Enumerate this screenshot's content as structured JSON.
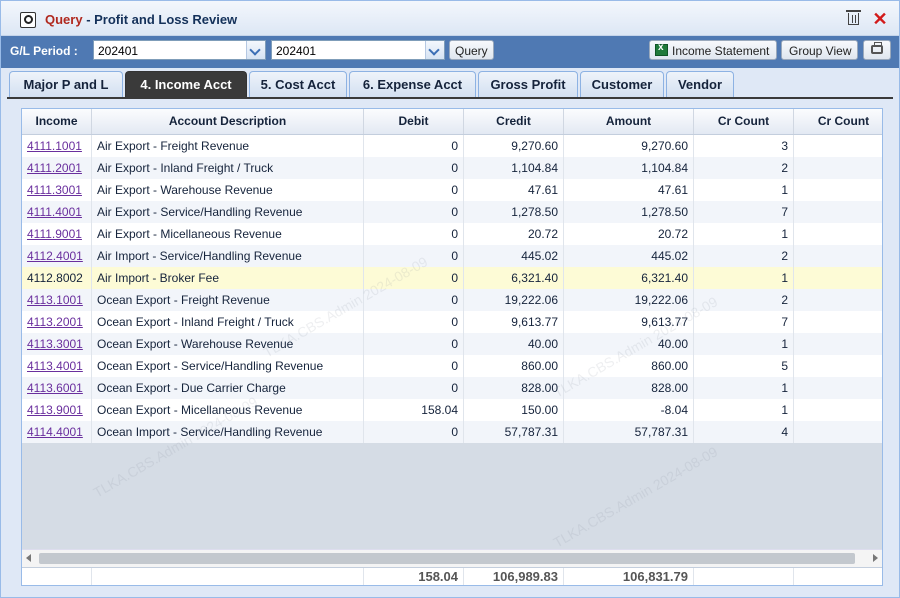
{
  "window": {
    "title_prefix": "Query",
    "title_rest": " - Profit and Loss Review"
  },
  "toolbar": {
    "gl_period_label": "G/L Period :",
    "period_from": "202401",
    "period_to": "202401",
    "query_label": "Query",
    "income_statement_label": "Income Statement",
    "group_view_label": "Group View"
  },
  "tabs": [
    {
      "label": "Major P and L",
      "active": false
    },
    {
      "label": "4. Income Acct",
      "active": true
    },
    {
      "label": "5. Cost Acct",
      "active": false
    },
    {
      "label": "6. Expense Acct",
      "active": false
    },
    {
      "label": "Gross Profit",
      "active": false
    },
    {
      "label": "Customer",
      "active": false
    },
    {
      "label": "Vendor",
      "active": false
    }
  ],
  "grid": {
    "columns": [
      "Income",
      "Account Description",
      "Debit",
      "Credit",
      "Amount",
      "Cr Count",
      "Cr Count"
    ],
    "rows": [
      {
        "acct": "4111.1001",
        "desc": "Air Export - Freight Revenue",
        "debit": "0",
        "credit": "9,270.60",
        "amount": "9,270.60",
        "cr_count": "3"
      },
      {
        "acct": "4111.2001",
        "desc": "Air Export - Inland Freight / Truck",
        "debit": "0",
        "credit": "1,104.84",
        "amount": "1,104.84",
        "cr_count": "2"
      },
      {
        "acct": "4111.3001",
        "desc": "Air Export - Warehouse Revenue",
        "debit": "0",
        "credit": "47.61",
        "amount": "47.61",
        "cr_count": "1"
      },
      {
        "acct": "4111.4001",
        "desc": "Air Export - Service/Handling Revenue",
        "debit": "0",
        "credit": "1,278.50",
        "amount": "1,278.50",
        "cr_count": "7"
      },
      {
        "acct": "4111.9001",
        "desc": "Air Export - Micellaneous Revenue",
        "debit": "0",
        "credit": "20.72",
        "amount": "20.72",
        "cr_count": "1"
      },
      {
        "acct": "4112.4001",
        "desc": "Air Import - Service/Handling Revenue",
        "debit": "0",
        "credit": "445.02",
        "amount": "445.02",
        "cr_count": "2"
      },
      {
        "acct": "4112.8002",
        "desc": "Air Import - Broker Fee",
        "debit": "0",
        "credit": "6,321.40",
        "amount": "6,321.40",
        "cr_count": "1"
      },
      {
        "acct": "4113.1001",
        "desc": "Ocean Export - Freight Revenue",
        "debit": "0",
        "credit": "19,222.06",
        "amount": "19,222.06",
        "cr_count": "2"
      },
      {
        "acct": "4113.2001",
        "desc": "Ocean Export - Inland Freight / Truck",
        "debit": "0",
        "credit": "9,613.77",
        "amount": "9,613.77",
        "cr_count": "7"
      },
      {
        "acct": "4113.3001",
        "desc": "Ocean Export - Warehouse Revenue",
        "debit": "0",
        "credit": "40.00",
        "amount": "40.00",
        "cr_count": "1"
      },
      {
        "acct": "4113.4001",
        "desc": "Ocean Export - Service/Handling Revenue",
        "debit": "0",
        "credit": "860.00",
        "amount": "860.00",
        "cr_count": "5"
      },
      {
        "acct": "4113.6001",
        "desc": "Ocean Export - Due Carrier Charge",
        "debit": "0",
        "credit": "828.00",
        "amount": "828.00",
        "cr_count": "1"
      },
      {
        "acct": "4113.9001",
        "desc": "Ocean Export - Micellaneous Revenue",
        "debit": "158.04",
        "credit": "150.00",
        "amount": "-8.04",
        "cr_count": "1"
      },
      {
        "acct": "4114.4001",
        "desc": "Ocean Import - Service/Handling Revenue",
        "debit": "0",
        "credit": "57,787.31",
        "amount": "57,787.31",
        "cr_count": "4"
      }
    ],
    "totals": {
      "debit": "158.04",
      "credit": "106,989.83",
      "amount": "106,831.79"
    }
  },
  "watermark": "TLKA.CBS.Admin 2024-08-09"
}
